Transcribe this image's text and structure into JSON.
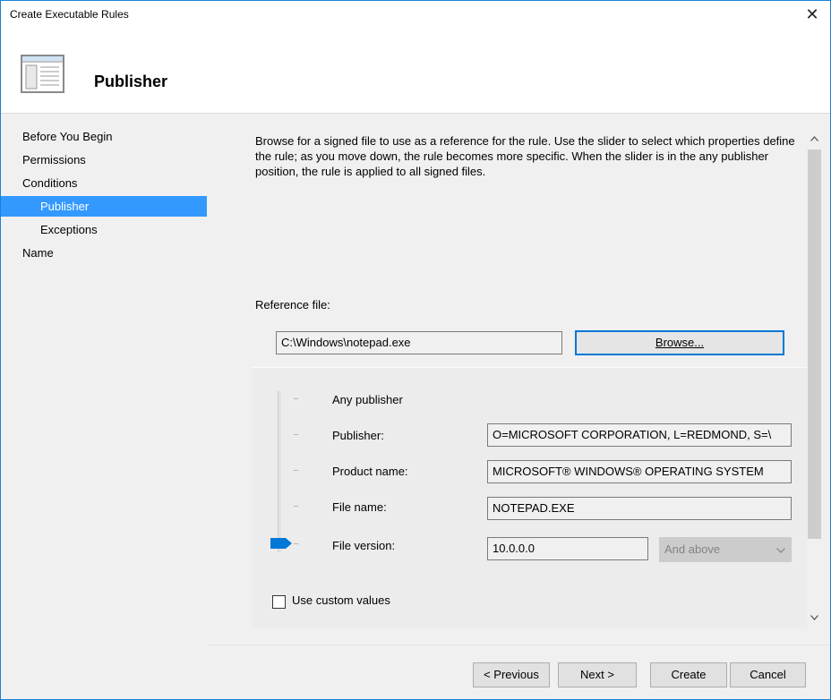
{
  "window": {
    "title": "Create Executable Rules",
    "close_glyph": "✕"
  },
  "header": {
    "title": "Publisher",
    "icon": "wizard-page-icon"
  },
  "nav": {
    "items": [
      {
        "label": "Before You Begin"
      },
      {
        "label": "Permissions"
      },
      {
        "label": "Conditions"
      },
      {
        "label": "Publisher"
      },
      {
        "label": "Exceptions"
      },
      {
        "label": "Name"
      }
    ],
    "selected": "Publisher"
  },
  "main": {
    "description": "Browse for a signed file to use as a reference for the rule. Use the slider to select which properties define the rule; as you move down, the rule becomes more specific. When the slider is in the any publisher position, the rule is applied to all signed files.",
    "reference_label": "Reference file:",
    "reference_value": "C:\\Windows\\notepad.exe",
    "browse_label": "Browse...",
    "levels": {
      "any_publisher": "Any publisher",
      "publisher_label": "Publisher:",
      "publisher_value": "O=MICROSOFT CORPORATION, L=REDMOND, S=\\",
      "product_label": "Product name:",
      "product_value": "MICROSOFT® WINDOWS® OPERATING SYSTEM",
      "filename_label": "File name:",
      "filename_value": "NOTEPAD.EXE",
      "version_label": "File version:",
      "version_value": "10.0.0.0",
      "version_mode": "And above"
    },
    "slider_position": "File version",
    "custom_values_label": "Use custom values",
    "custom_values_checked": false
  },
  "footer": {
    "previous": "< Previous",
    "next": "Next >",
    "create": "Create",
    "cancel": "Cancel"
  },
  "colors": {
    "accent": "#3399ff",
    "border": "#1883d7",
    "slider_thumb": "#0078d7"
  }
}
